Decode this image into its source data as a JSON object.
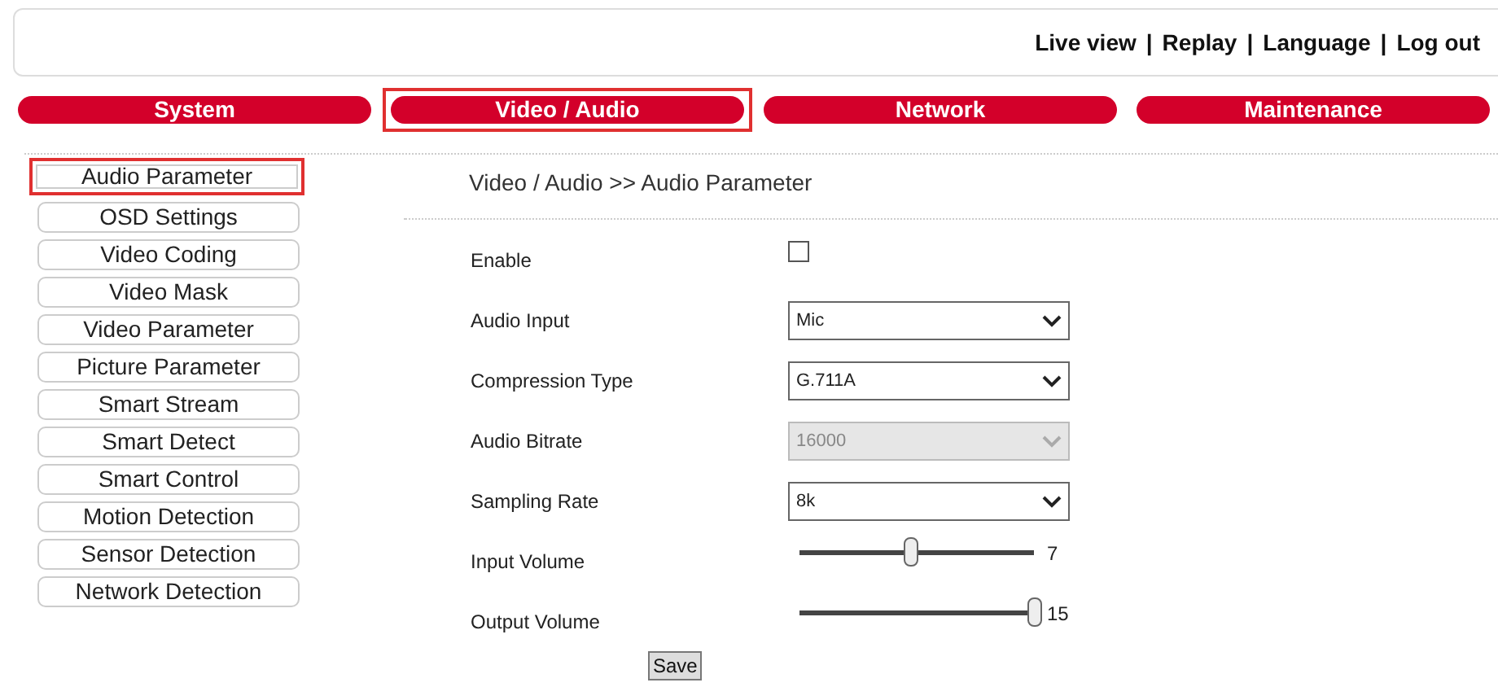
{
  "header_links": [
    "Live view",
    "Replay",
    "Language",
    "Log out"
  ],
  "header_separators": [
    "|",
    "|",
    "|"
  ],
  "tabs": [
    {
      "label": "System",
      "selected": false
    },
    {
      "label": "Video / Audio",
      "selected": true
    },
    {
      "label": "Network",
      "selected": false
    },
    {
      "label": "Maintenance",
      "selected": false
    }
  ],
  "sidebar": {
    "items": [
      {
        "label": "Audio Parameter",
        "selected": true
      },
      {
        "label": "OSD Settings",
        "selected": false
      },
      {
        "label": "Video Coding",
        "selected": false
      },
      {
        "label": "Video Mask",
        "selected": false
      },
      {
        "label": "Video Parameter",
        "selected": false
      },
      {
        "label": "Picture Parameter",
        "selected": false
      },
      {
        "label": "Smart Stream",
        "selected": false
      },
      {
        "label": "Smart Detect",
        "selected": false
      },
      {
        "label": "Smart Control",
        "selected": false
      },
      {
        "label": "Motion Detection",
        "selected": false
      },
      {
        "label": "Sensor Detection",
        "selected": false
      },
      {
        "label": "Network Detection",
        "selected": false
      }
    ]
  },
  "breadcrumb": "Video / Audio >> Audio Parameter",
  "fields": [
    {
      "kind": "checkbox",
      "label": "Enable",
      "checked": false
    },
    {
      "kind": "select",
      "label": "Audio Input",
      "value": "Mic",
      "disabled": false
    },
    {
      "kind": "select",
      "label": "Compression Type",
      "value": "G.711A",
      "disabled": false
    },
    {
      "kind": "select",
      "label": "Audio Bitrate",
      "value": "16000",
      "disabled": true
    },
    {
      "kind": "select",
      "label": "Sampling Rate",
      "value": "8k",
      "disabled": false
    },
    {
      "kind": "slider",
      "label": "Input Volume",
      "level": 0.47,
      "reading": "7"
    },
    {
      "kind": "slider",
      "label": "Output Volume",
      "level": 1.0,
      "reading": "15"
    }
  ],
  "save_button": "Save"
}
